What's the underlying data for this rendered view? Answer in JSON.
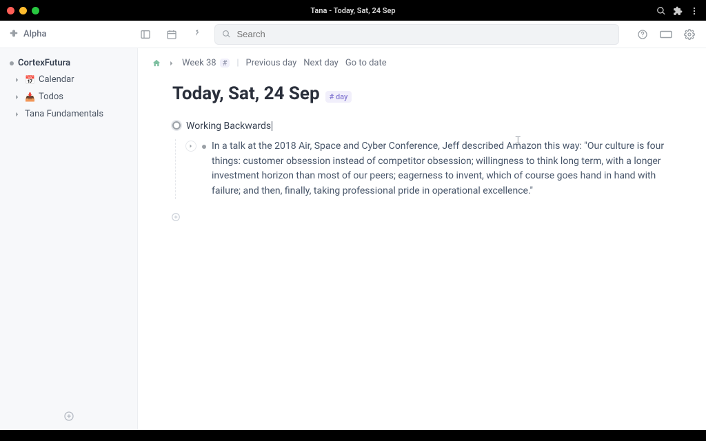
{
  "titlebar": {
    "title": "Tana - Today, Sat, 24 Sep"
  },
  "toolbar": {
    "workspace_name": "Alpha",
    "search_placeholder": "Search"
  },
  "sidebar": {
    "title": "CortexFutura",
    "items": [
      {
        "emoji": "📅",
        "label": "Calendar"
      },
      {
        "emoji": "📥",
        "label": "Todos"
      },
      {
        "emoji": "",
        "label": "Tana Fundamentals"
      }
    ]
  },
  "breadcrumbs": {
    "week": "Week 38",
    "hash": "#",
    "prev": "Previous day",
    "next": "Next day",
    "goto": "Go to date"
  },
  "page": {
    "title": "Today, Sat, 24 Sep",
    "tag": "# day"
  },
  "outline": {
    "node1": {
      "text": "Working Backwards",
      "child1": "In a talk at the 2018 Air, Space and Cyber Conference, Jeff described Amazon this way: \"Our culture is four things: customer obsession instead of competitor obsession; willingness to think long term, with a longer investment horizon than most of our peers; eagerness to invent, which of course goes hand in hand with failure; and then, finally, taking professional pride in operational excellence.\""
    }
  }
}
